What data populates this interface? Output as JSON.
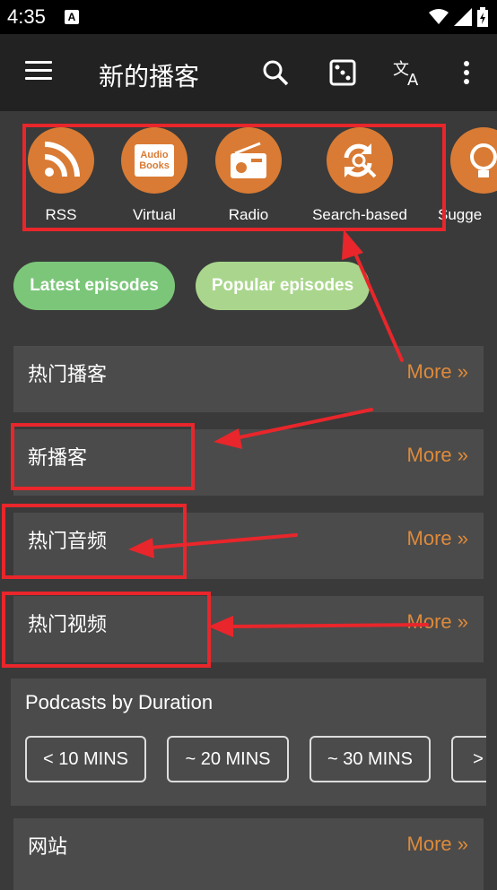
{
  "status": {
    "time": "4:35",
    "notif_letter": "A"
  },
  "toolbar": {
    "title": "新的播客"
  },
  "types": [
    {
      "label": "RSS",
      "icon": "rss-icon"
    },
    {
      "label": "Virtual",
      "icon": "audio-books-icon",
      "icon_text_line1": "Audio",
      "icon_text_line2": "Books"
    },
    {
      "label": "Radio",
      "icon": "radio-icon"
    },
    {
      "label": "Search-based",
      "icon": "search-refresh-icon"
    },
    {
      "label": "Sugge",
      "icon": "lightbulb-icon"
    }
  ],
  "chips": {
    "latest": "Latest episodes",
    "popular": "Popular episodes"
  },
  "cards": [
    {
      "title": "热门播客",
      "more": "More »"
    },
    {
      "title": "新播客",
      "more": "More »"
    },
    {
      "title": "热门音频",
      "more": "More »"
    },
    {
      "title": "热门视频",
      "more": "More »"
    }
  ],
  "duration": {
    "title": "Podcasts by Duration",
    "options": [
      "< 10 MINS",
      "~ 20 MINS",
      "~ 30 MINS",
      ">"
    ]
  },
  "website": {
    "title": "网站",
    "more": "More »"
  },
  "colors": {
    "accent": "#d97b34",
    "more_link": "#de8a3a",
    "annotation": "#e8262b",
    "chip_latest": "#7cc67a",
    "chip_popular": "#a9d68c"
  }
}
